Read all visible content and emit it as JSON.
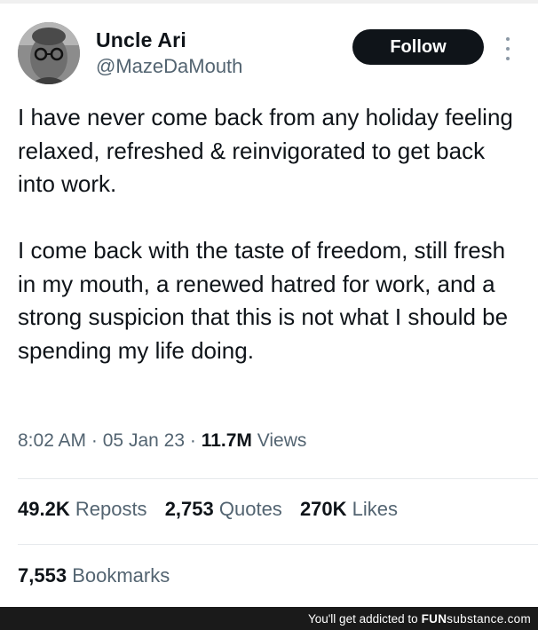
{
  "author": {
    "display_name": "Uncle Ari",
    "handle": "@MazeDaMouth",
    "avatar_icon": "profile-photo-avatar"
  },
  "follow_label": "Follow",
  "more_icon": "vertical-ellipsis-icon",
  "tweet": {
    "paragraphs": [
      "I have never come back from any holiday feeling relaxed, refreshed & reinvigorated to get back into work.",
      "I come back with the taste of freedom, still fresh in my mouth, a renewed hatred for work, and a strong suspicion that this is not what I should be spending my life doing."
    ]
  },
  "meta": {
    "time": "8:02 AM",
    "date": "05 Jan 23",
    "views_count": "11.7M",
    "views_label": "Views",
    "separator": "·"
  },
  "stats": {
    "reposts_count": "49.2K",
    "reposts_label": "Reposts",
    "quotes_count": "2,753",
    "quotes_label": "Quotes",
    "likes_count": "270K",
    "likes_label": "Likes",
    "bookmarks_count": "7,553",
    "bookmarks_label": "Bookmarks"
  },
  "footer": {
    "prefix": "You'll get addicted to",
    "brand_bold": "FUN",
    "brand_rest": "substance.com"
  },
  "colors": {
    "text_primary": "#0f1419",
    "text_secondary": "#536471",
    "button_bg": "#0f1419",
    "footer_bg": "#1a1a1a"
  }
}
